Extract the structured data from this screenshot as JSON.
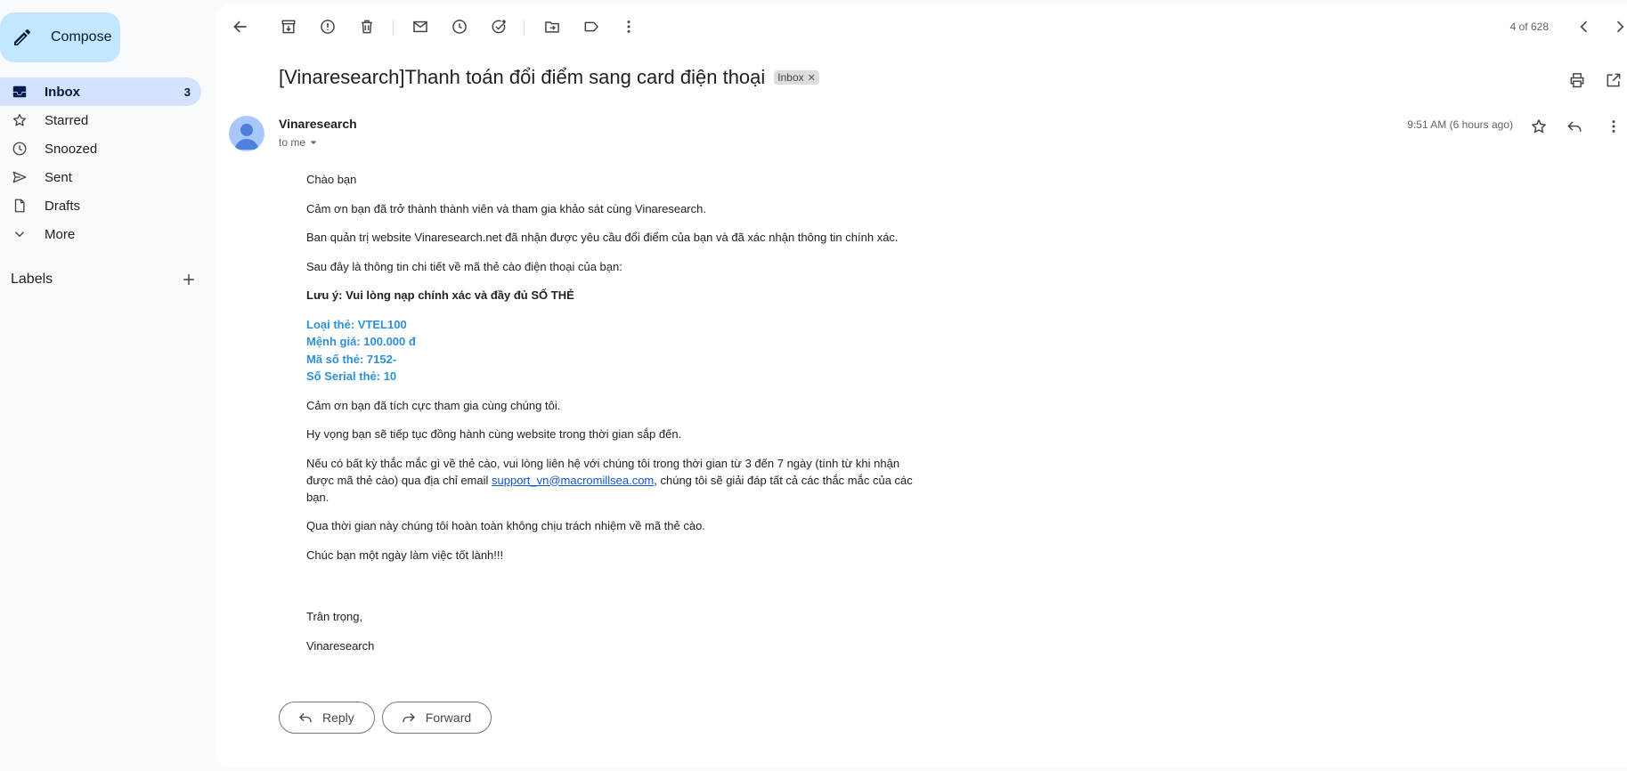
{
  "sidebar": {
    "compose_label": "Compose",
    "items": [
      {
        "label": "Inbox",
        "icon": "inbox-icon",
        "count": "3"
      },
      {
        "label": "Starred",
        "icon": "star-icon"
      },
      {
        "label": "Snoozed",
        "icon": "clock-icon"
      },
      {
        "label": "Sent",
        "icon": "send-icon"
      },
      {
        "label": "Drafts",
        "icon": "draft-icon"
      },
      {
        "label": "More",
        "icon": "chevron-down-icon"
      }
    ],
    "labels_heading": "Labels"
  },
  "toolbar": {
    "pager": "4 of 628"
  },
  "email": {
    "subject": "[Vinaresearch]Thanh toán đổi điểm sang card điện thoại",
    "label_chip": "Inbox",
    "sender": "Vinaresearch",
    "recipient": "to me",
    "time": "9:51 AM (6 hours ago)",
    "body": {
      "greeting": "Chào bạn",
      "p1": "Cảm ơn bạn đã trở thành thành viên và tham gia khảo sát cùng Vinaresearch.",
      "p2": "Ban quản trị website Vinaresearch.net đã nhận được yêu cầu đổi điểm của bạn và đã xác nhận thông tin chính xác.",
      "p3": "Sau đây là thông tin chi tiết về mã thẻ cào điện thoại của bạn:",
      "note": "Lưu ý: Vui lòng nạp chính xác và đầy đủ SỐ THẺ",
      "card_type": "Loại thẻ: VTEL100",
      "card_value": "Mệnh giá: 100.000 đ",
      "card_code": "Mã số thẻ: 7152-",
      "card_serial": "Số Serial thẻ: 10",
      "p4": "Cảm ơn bạn đã tích cực tham gia cùng chúng tôi.",
      "p5": "Hy vọng bạn sẽ tiếp tục đồng hành cùng website trong thời gian sắp đến.",
      "p6_before": "Nếu có bất kỳ thắc mắc gì về thẻ cào, vui lòng liên hệ với chúng tôi trong thời gian từ 3 đến 7 ngày (tính từ khi nhận được mã thẻ cào) qua địa chỉ email ",
      "p6_link": "support_vn@macromillsea.com",
      "p6_after": ", chúng tôi sẽ giải đáp tất cả các thắc mắc của các bạn.",
      "p7": "Qua thời gian này chúng tôi hoàn toàn không chịu trách nhiệm về mã thẻ cào.",
      "p8": "Chúc bạn một ngày làm việc tốt lành!!!",
      "closing": "Trân trọng,",
      "signature": "Vinaresearch"
    },
    "reply_label": "Reply",
    "forward_label": "Forward"
  },
  "colors": {
    "compose_bg": "#c2e7ff",
    "inbox_active_bg": "#d3e3fd",
    "card_text": "#2f8fd8",
    "link": "#1155cc"
  }
}
